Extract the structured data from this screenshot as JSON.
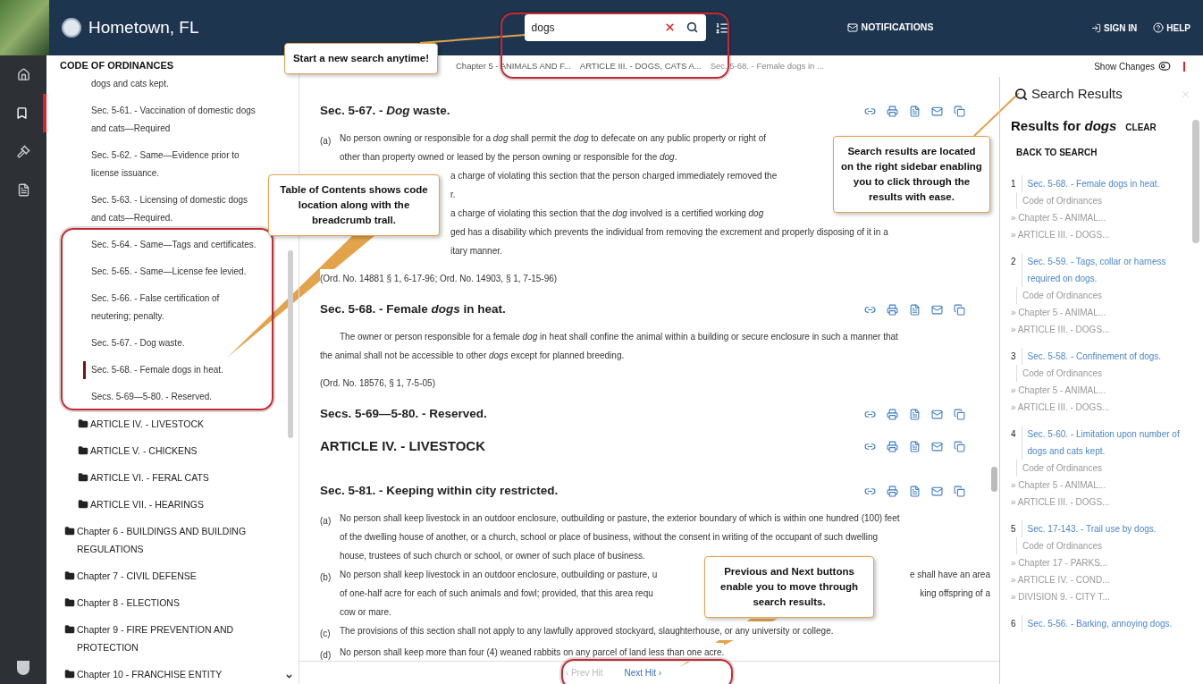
{
  "header": {
    "site_title": "Hometown, FL",
    "search": {
      "value": "dogs"
    },
    "notifications": "NOTIFICATIONS",
    "sign_in": "SIGN IN",
    "help": "HELP"
  },
  "rail": [
    {
      "kind": "home",
      "selected": false
    },
    {
      "kind": "bookmark",
      "selected": true
    },
    {
      "kind": "gavel",
      "selected": false
    },
    {
      "kind": "document",
      "selected": false
    }
  ],
  "toc": {
    "title": "CODE OF ORDINANCES",
    "items": [
      {
        "kind": "group",
        "children": [
          {
            "kind": "group",
            "children": [
              {
                "kind": "section",
                "label": "dogs and cats kept.",
                "selected": false
              },
              {
                "kind": "section",
                "label": "Sec. 5-61. - Vaccination of domestic dogs and cats—Required",
                "selected": false
              },
              {
                "kind": "section",
                "label": "Sec. 5-62. - Same—Evidence prior to license issuance.",
                "selected": false
              },
              {
                "kind": "section",
                "label": "Sec. 5-63. - Licensing of domestic dogs and cats—Required.",
                "selected": false
              },
              {
                "kind": "section",
                "label": "Sec. 5-64. - Same—Tags and certificates.",
                "selected": false
              },
              {
                "kind": "section",
                "label": "Sec. 5-65. - Same—License fee levied.",
                "selected": false
              },
              {
                "kind": "section",
                "label": "Sec. 5-66. - False certification of neutering; penalty.",
                "selected": false
              },
              {
                "kind": "section",
                "label": "Sec. 5-67. - Dog waste.",
                "selected": false
              },
              {
                "kind": "section",
                "label": "Sec. 5-68. - Female dogs in heat.",
                "selected": true
              },
              {
                "kind": "section",
                "label": "Secs. 5-69—5-80. - Reserved.",
                "selected": false
              }
            ]
          },
          {
            "kind": "folder",
            "label": "ARTICLE IV. - LIVESTOCK"
          },
          {
            "kind": "folder",
            "label": "ARTICLE V. - CHICKENS"
          },
          {
            "kind": "folder",
            "label": "ARTICLE VI. - FERAL CATS"
          },
          {
            "kind": "folder",
            "label": "ARTICLE VII. - HEARINGS"
          }
        ]
      },
      {
        "kind": "folder",
        "label": "Chapter 6 - BUILDINGS AND BUILDING REGULATIONS"
      },
      {
        "kind": "folder",
        "label": "Chapter 7 - CIVIL DEFENSE"
      },
      {
        "kind": "folder",
        "label": "Chapter 8 - ELECTIONS"
      },
      {
        "kind": "folder",
        "label": "Chapter 9 - FIRE PREVENTION AND PROTECTION"
      },
      {
        "kind": "folder",
        "label": "Chapter 10 - FRANCHISE ENTITY"
      }
    ]
  },
  "breadcrumb": [
    "Chapter 5 - ANIMALS AND F...",
    "ARTICLE III. - DOGS, CATS A...",
    "Sec. 5-68. - Female dogs in ..."
  ],
  "show_changes": {
    "label": "Show Changes",
    "on": false
  },
  "sections": [
    {
      "kind": "section",
      "title": "Sec. 5-67. - *Dog* waste.",
      "paragraphs": [
        {
          "label": "(a)",
          "lines": [
            {
              "text": "No person owning or responsible for a *dog* shall permit the *dog* to defecate on any public property or right of"
            },
            {
              "text": "other than property owned or leased by the person owning or responsible for the *dog*."
            }
          ]
        },
        {
          "lines": [
            {
              "kind": "covered",
              "text": "a charge of violating this section that the person charged immediately removed the"
            },
            {
              "kind": "covered",
              "text": "r."
            },
            {
              "kind": "covered",
              "text": "a charge of violating this section that the *dog* involved is a certified working *dog*"
            },
            {
              "kind": "covered",
              "text": "ged has a disability which prevents the individual from removing the excrement and properly disposing of it in a"
            },
            {
              "kind": "covered",
              "text": "itary manner."
            }
          ]
        }
      ],
      "history": "(Ord. No. 14881 § 1, 6-17-96; Ord. No. 14903, § 1, 7-15-96)"
    },
    {
      "kind": "section",
      "title": "Sec. 5-68. - Female *dogs* in heat.",
      "paragraphs": [
        {
          "lines": [
            {
              "kind": "first",
              "text": "The owner or person responsible for a female *dog* in heat shall confine the animal within a building or secure enclosure in such a manner that"
            },
            {
              "kind": "flush",
              "text": "the animal shall not be accessible to other *dogs* except for planned breeding."
            }
          ]
        }
      ],
      "history": "(Ord. No. 18576, § 1, 7-5-05)"
    },
    {
      "kind": "section",
      "title": "Secs. 5-69—5-80. - Reserved."
    },
    {
      "kind": "article",
      "title": "ARTICLE IV. - LIVESTOCK"
    },
    {
      "kind": "section",
      "title": "Sec. 5-81. - Keeping within city restricted.",
      "paragraphs": [
        {
          "label": "(a)",
          "lines": [
            {
              "text": "No person shall keep livestock in an outdoor enclosure, outbuilding or pasture, the exterior boundary of which is within one hundred (100) feet"
            },
            {
              "text": "of the dwelling house of another, or a church, school or place of business, without the consent in writing of the occupant of such dwelling"
            },
            {
              "text": "house, trustees of such church or school, or owner of such place of business."
            }
          ]
        },
        {
          "label": "(b)",
          "lines": [
            {
              "kind": "split",
              "left": "No person shall keep livestock in an outdoor enclosure, outbuilding or pasture, u",
              "right": "e shall have an area"
            },
            {
              "kind": "split",
              "left": "of one-half acre for each of such animals and fowl; provided, that this area requ",
              "right": "king offspring of a"
            },
            {
              "text": "cow or mare."
            }
          ]
        },
        {
          "label": "(c)",
          "lines": [
            {
              "text": "The provisions of this section shall not apply to any lawfully approved stockyard, slaughterhouse, or any university or college."
            }
          ]
        },
        {
          "label": "(d)",
          "lines": [
            {
              "text": "No person shall keep more than four (4) weaned rabbits on any parcel of land less than one acre."
            }
          ]
        }
      ]
    }
  ],
  "pager": {
    "prev": {
      "label": "‹ Prev Hit",
      "disabled": true
    },
    "next": {
      "label": "Next Hit ›",
      "disabled": false
    }
  },
  "search_results": {
    "title": "Search Results",
    "heading": "Results for *dogs*",
    "clear": "CLEAR",
    "back": "BACK TO SEARCH",
    "results": [
      {
        "number": "1",
        "title": "Sec. 5-68. - Female dogs in heat.",
        "path": [
          "Code of Ordinances",
          "» Chapter 5 - ANIMAL...",
          "» ARTICLE III. - DOGS..."
        ]
      },
      {
        "number": "2",
        "title": "Sec. 5-59. - Tags, collar or harness required on dogs.",
        "path": [
          "Code of Ordinances",
          "» Chapter 5 - ANIMAL...",
          "» ARTICLE III. - DOGS..."
        ]
      },
      {
        "number": "3",
        "title": "Sec. 5-58. - Confinement of dogs.",
        "path": [
          "Code of Ordinances",
          "» Chapter 5 - ANIMAL...",
          "» ARTICLE III. - DOGS..."
        ]
      },
      {
        "number": "4",
        "title": "Sec. 5-60. - Limitation upon number of dogs and cats kept.",
        "path": [
          "Code of Ordinances",
          "» Chapter 5 - ANIMAL...",
          "» ARTICLE III. - DOGS..."
        ]
      },
      {
        "number": "5",
        "title": "Sec. 17-143. - Trail use by dogs.",
        "path": [
          "Code of Ordinances",
          "» Chapter 17 - PARKS...",
          "» ARTICLE IV. - COND...",
          "» DIVISION 9. - CITY T..."
        ]
      },
      {
        "number": "6",
        "title": "Sec. 5-56. - Barking, annoying dogs."
      }
    ]
  },
  "callouts": [
    {
      "kind": "search",
      "text": "Start a new search anytime!"
    },
    {
      "kind": "toc",
      "text": "Table of Contents shows code location along with the breadcrumb trall."
    },
    {
      "kind": "results",
      "text": "Search results are located on the right sidebar enabling you to click through the results with ease."
    },
    {
      "kind": "pager",
      "text": "Previous and Next buttons enable you to move through search results."
    }
  ]
}
